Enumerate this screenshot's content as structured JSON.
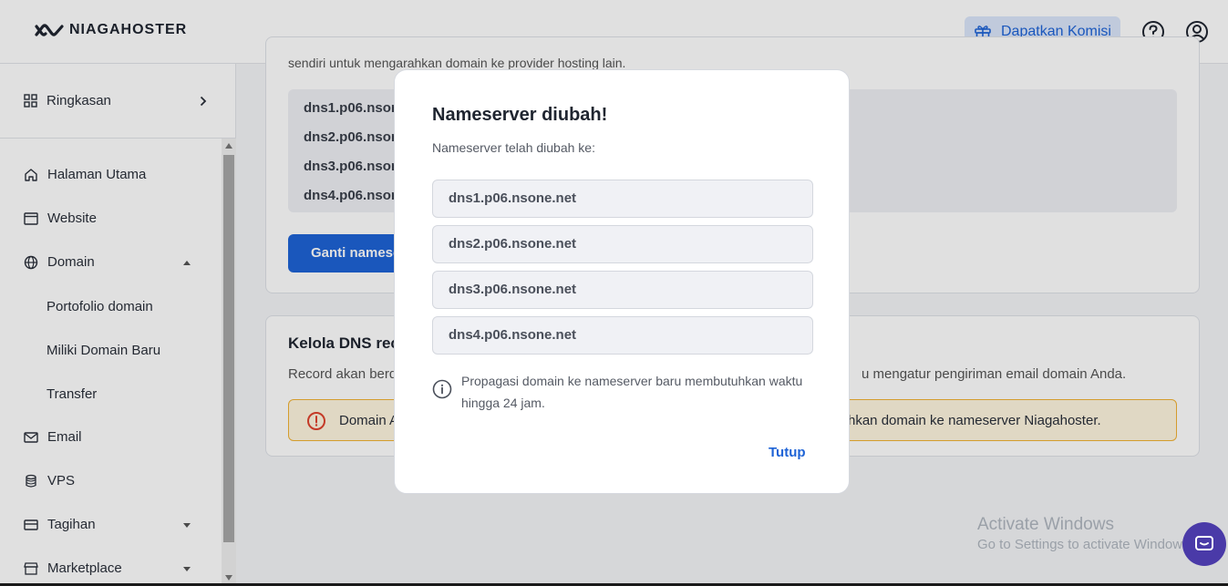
{
  "header": {
    "logo_text": "NIAGAHOSTER",
    "komisi_label": "Dapatkan Komisi"
  },
  "sidebar": {
    "summary_label": "Ringkasan",
    "items": [
      {
        "label": "Halaman Utama",
        "icon": "home-icon"
      },
      {
        "label": "Website",
        "icon": "browser-icon"
      },
      {
        "label": "Domain",
        "icon": "globe-icon"
      },
      {
        "label": "Email",
        "icon": "mail-icon"
      },
      {
        "label": "VPS",
        "icon": "database-icon"
      },
      {
        "label": "Tagihan",
        "icon": "card-icon"
      },
      {
        "label": "Marketplace",
        "icon": "store-icon"
      }
    ],
    "domain_sub": [
      "Portofolio domain",
      "Miliki Domain Baru",
      "Transfer"
    ]
  },
  "main": {
    "card1_text": "sendiri untuk mengarahkan domain ke provider hosting lain.",
    "nameservers": [
      "dns1.p06.nsone",
      "dns2.p06.nsone",
      "dns3.p06.nsone",
      "dns4.p06.nsone"
    ],
    "ganti_label": "Ganti namese",
    "dns_title": "Kelola DNS reco",
    "dns_desc_left": "Record akan berd",
    "dns_desc_right": "u mengatur pengiriman email domain Anda.",
    "warn_left": "Domain A",
    "warn_right": "hkan domain ke nameserver Niagahoster."
  },
  "modal": {
    "title": "Nameserver diubah!",
    "subtitle": "Nameserver telah diubah ke:",
    "nameservers": [
      "dns1.p06.nsone.net",
      "dns2.p06.nsone.net",
      "dns3.p06.nsone.net",
      "dns4.p06.nsone.net"
    ],
    "info": "Propagasi domain ke nameserver baru membutuhkan waktu hingga 24 jam.",
    "close_label": "Tutup"
  },
  "watermark": {
    "line1": "Activate Windows",
    "line2": "Go to Settings to activate Windows."
  },
  "colors": {
    "primary": "#1e63d6",
    "warning": "#f2b234"
  }
}
